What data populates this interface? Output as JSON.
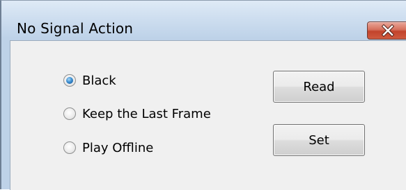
{
  "window": {
    "title": "No Signal Action",
    "close_icon": "close-icon"
  },
  "options": [
    {
      "label": "Black",
      "checked": true
    },
    {
      "label": "Keep the Last Frame",
      "checked": false
    },
    {
      "label": "Play Offline",
      "checked": false
    }
  ],
  "buttons": {
    "read_label": "Read",
    "set_label": "Set"
  },
  "colors": {
    "titlebar": "#cfdff0",
    "close_button": "#c2432b",
    "dialog_background": "#f0f0f0",
    "radio_selected": "#3d8fd1"
  }
}
